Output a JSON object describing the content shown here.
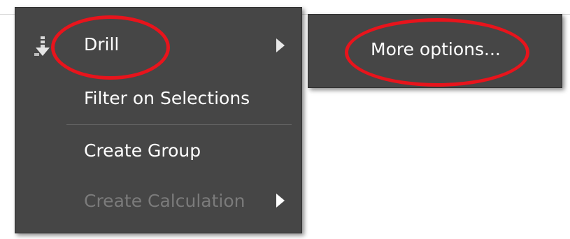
{
  "context_menu": {
    "items": [
      {
        "label": "Drill",
        "icon": "drill-down-icon",
        "has_submenu": true,
        "enabled": true
      },
      {
        "label": "Filter on Selections",
        "has_submenu": false,
        "enabled": true
      },
      {
        "label": "Create Group",
        "has_submenu": false,
        "enabled": true
      },
      {
        "label": "Create Calculation",
        "has_submenu": true,
        "enabled": false
      }
    ]
  },
  "submenu": {
    "items": [
      {
        "label": "More options..."
      }
    ]
  },
  "annotation": {
    "highlight_color": "#e8141c",
    "highlighted": [
      "Drill",
      "More options..."
    ]
  },
  "colors": {
    "menu_background": "#464646",
    "menu_text": "#ffffff",
    "disabled_text": "#7b7b7b"
  }
}
